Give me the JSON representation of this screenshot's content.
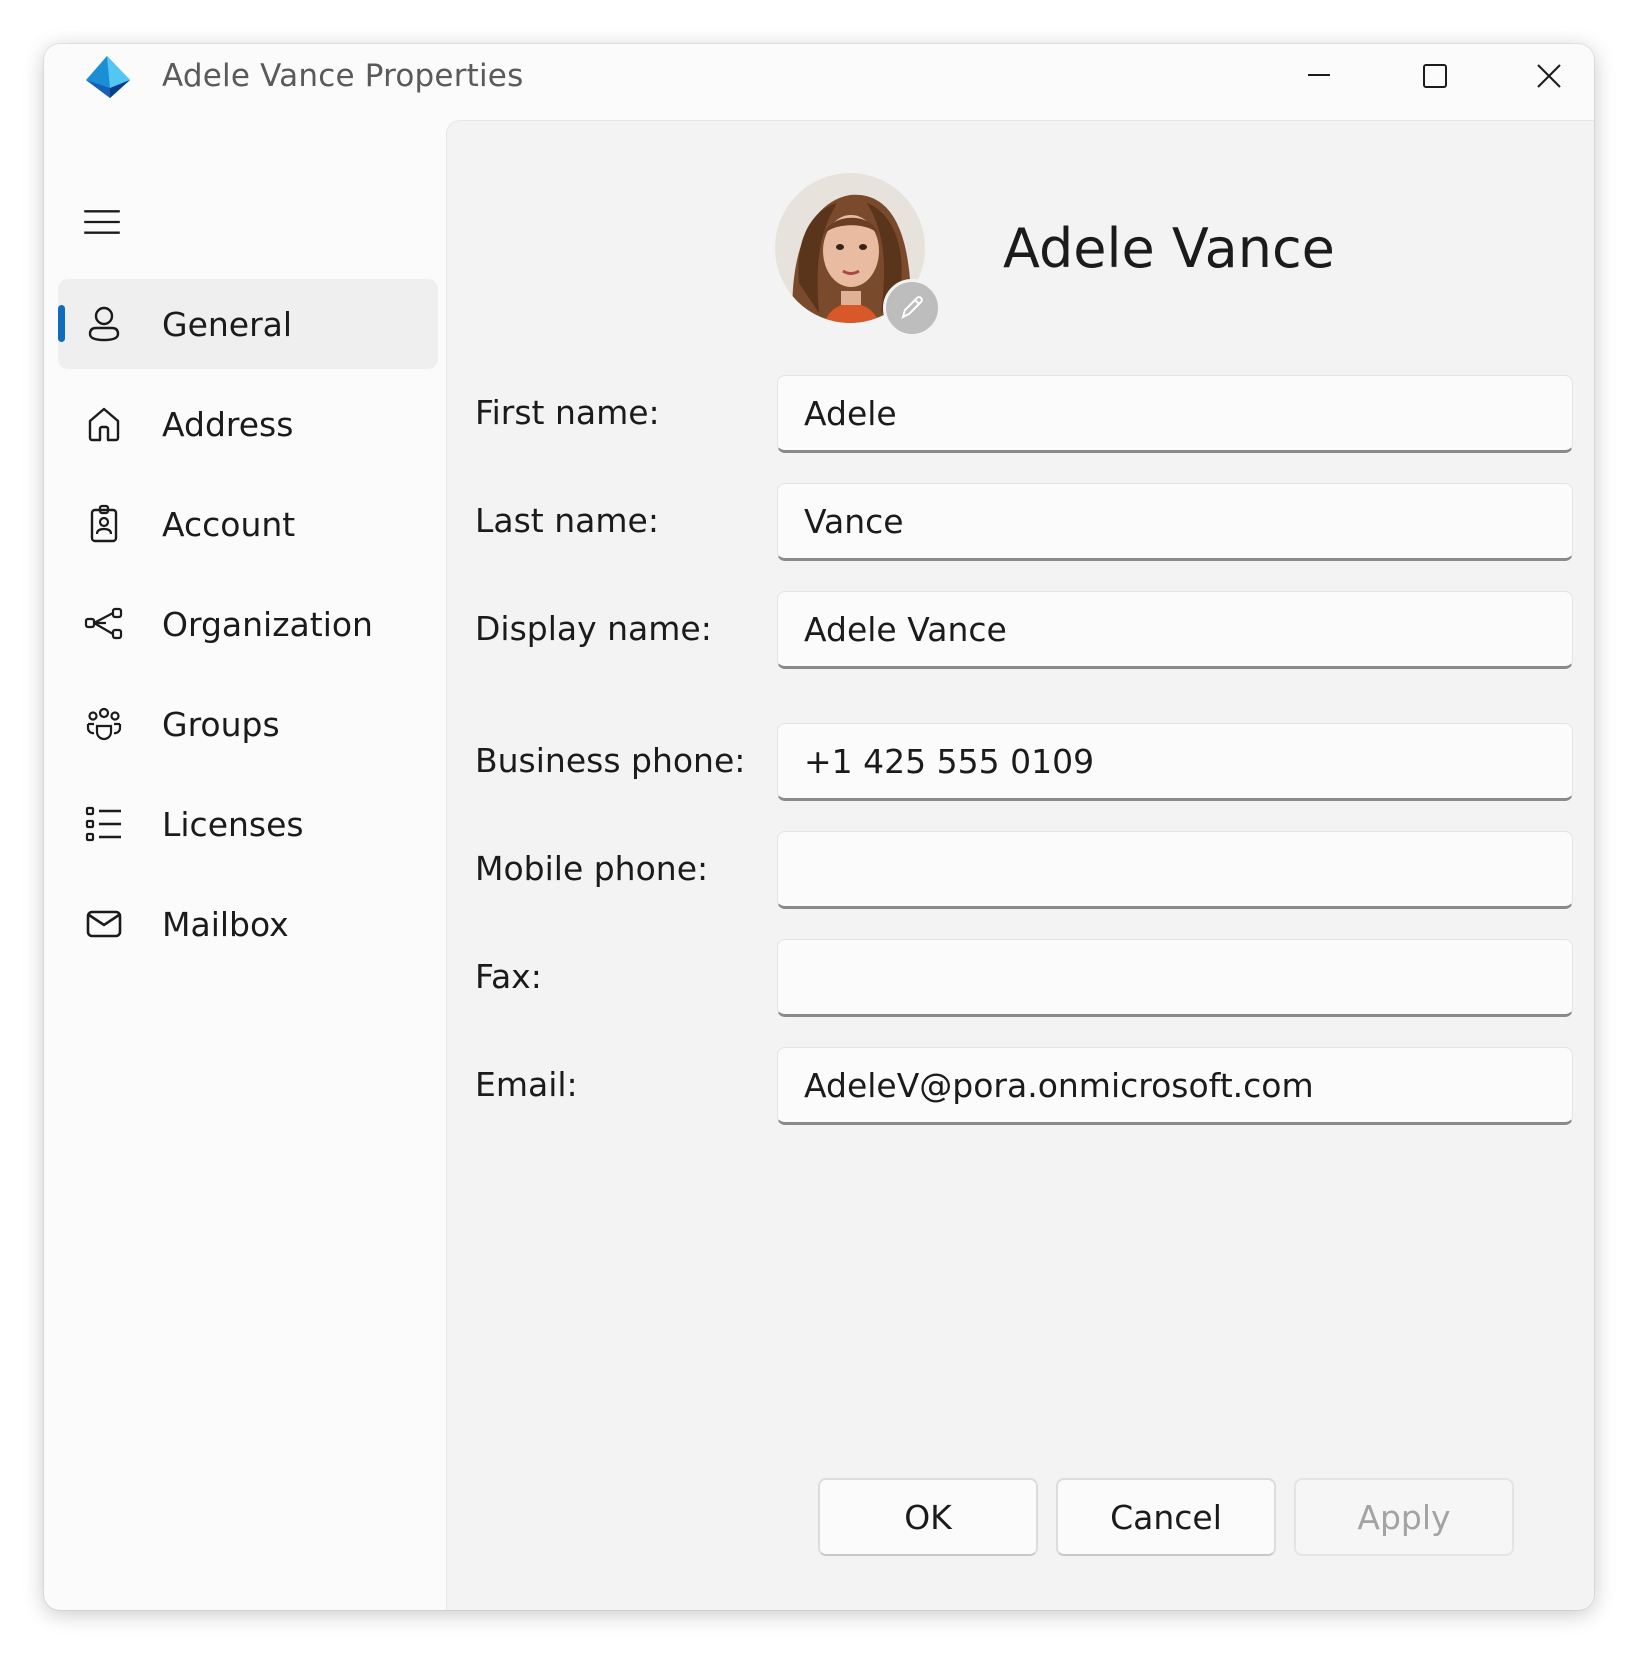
{
  "window": {
    "title": "Adele Vance Properties",
    "controls": {
      "minimize_icon": "minimize-icon",
      "maximize_icon": "maximize-icon",
      "close_icon": "close-icon"
    }
  },
  "sidebar": {
    "menu_icon": "hamburger-menu-icon",
    "active_index": 0,
    "accent_color": "#0f6cbd",
    "items": [
      {
        "label": "General",
        "icon": "person-icon"
      },
      {
        "label": "Address",
        "icon": "home-icon"
      },
      {
        "label": "Account",
        "icon": "badge-icon"
      },
      {
        "label": "Organization",
        "icon": "org-chart-icon"
      },
      {
        "label": "Groups",
        "icon": "people-team-icon"
      },
      {
        "label": "Licenses",
        "icon": "list-icon"
      },
      {
        "label": "Mailbox",
        "icon": "mail-icon"
      }
    ]
  },
  "profile": {
    "display_name": "Adele Vance",
    "avatar": "user-photo",
    "edit_icon": "pencil-icon"
  },
  "form": {
    "first_name": {
      "label": "First name:",
      "value": "Adele"
    },
    "last_name": {
      "label": "Last name:",
      "value": "Vance"
    },
    "display_name": {
      "label": "Display name:",
      "value": "Adele Vance"
    },
    "business_phone": {
      "label": "Business phone:",
      "value": "+1 425 555 0109"
    },
    "mobile_phone": {
      "label": "Mobile phone:",
      "value": ""
    },
    "fax": {
      "label": "Fax:",
      "value": ""
    },
    "email": {
      "label": "Email:",
      "value": "AdeleV@pora.onmicrosoft.com"
    }
  },
  "buttons": {
    "ok": "OK",
    "cancel": "Cancel",
    "apply": "Apply"
  }
}
